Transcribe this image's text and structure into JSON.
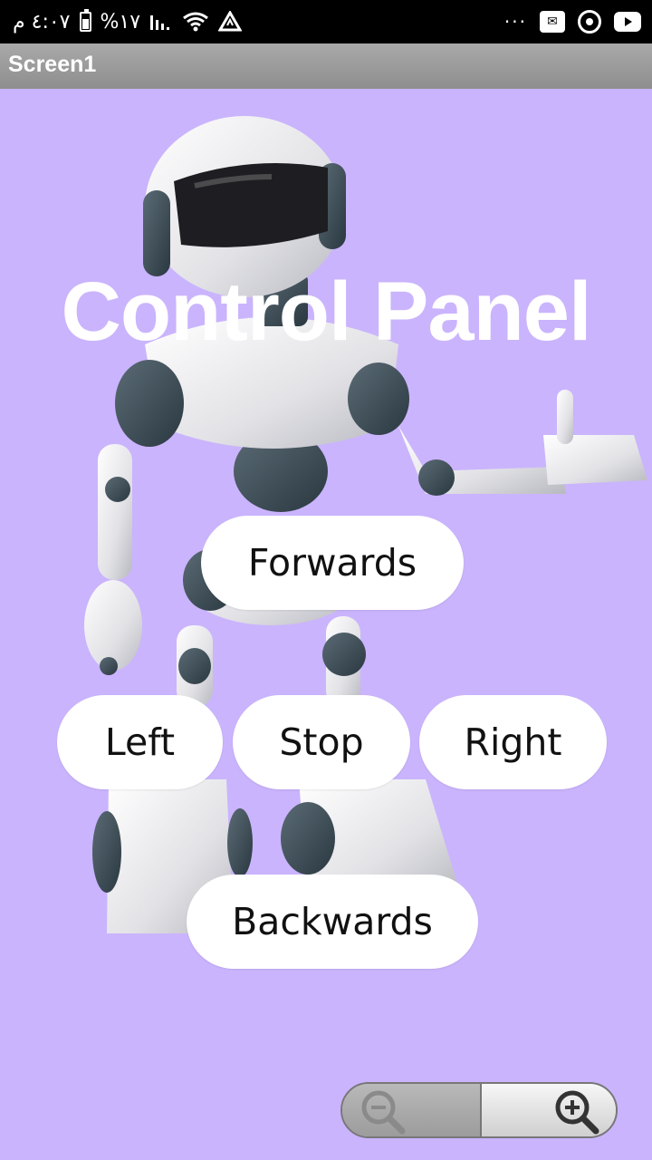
{
  "status_bar": {
    "time": "٤:٠٧ م",
    "battery": "%١٧"
  },
  "app_bar": {
    "title": "Screen1"
  },
  "main": {
    "heading": "Control Panel",
    "buttons": {
      "forwards": "Forwards",
      "left": "Left",
      "stop": "Stop",
      "right": "Right",
      "backwards": "Backwards"
    }
  },
  "colors": {
    "background": "#cab4fd",
    "button": "#ffffff",
    "status_bar": "#000000",
    "title_bar": "#9a9a9a"
  }
}
